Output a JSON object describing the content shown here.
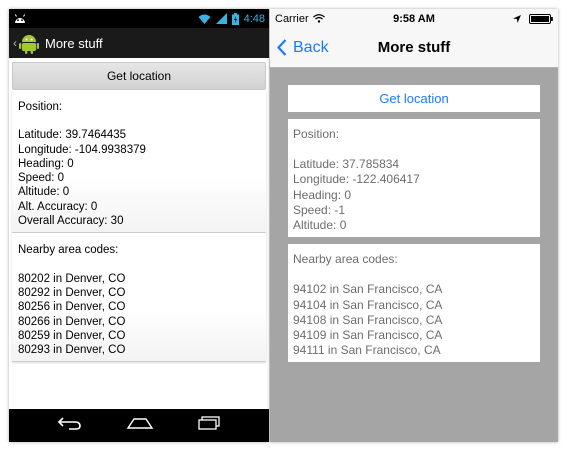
{
  "android": {
    "status_time": "4:48",
    "actionbar_title": "More stuff",
    "get_location_label": "Get location",
    "position": {
      "header": "Position:",
      "lines": [
        "Latitude: 39.7464435",
        "Longitude: -104.9938379",
        "Heading: 0",
        "Speed: 0",
        "Altitude: 0",
        "Alt. Accuracy: 0",
        "Overall Accuracy: 30"
      ]
    },
    "area": {
      "header": "Nearby area codes:",
      "lines": [
        "80202 in Denver, CO",
        "80292 in Denver, CO",
        "80256 in Denver, CO",
        "80266 in Denver, CO",
        "80259 in Denver, CO",
        "80293 in Denver, CO"
      ]
    },
    "colors": {
      "status_icon": "#34b5e5",
      "actionbar": "#1a1a1a"
    }
  },
  "ios": {
    "carrier": "Carrier",
    "status_time": "9:58 AM",
    "back_label": "Back",
    "nav_title": "More stuff",
    "get_location_label": "Get location",
    "position": {
      "header": "Position:",
      "lines": [
        "Latitude: 37.785834",
        "Longitude: -122.406417",
        "Heading: 0",
        "Speed: -1",
        "Altitude: 0"
      ]
    },
    "area": {
      "header": "Nearby area codes:",
      "lines": [
        "94102 in San Francisco, CA",
        "94104 in San Francisco, CA",
        "94108 in San Francisco, CA",
        "94109 in San Francisco, CA",
        "94111 in San Francisco, CA"
      ]
    },
    "colors": {
      "tint": "#1a7bff",
      "background": "#a5a5a5"
    }
  }
}
